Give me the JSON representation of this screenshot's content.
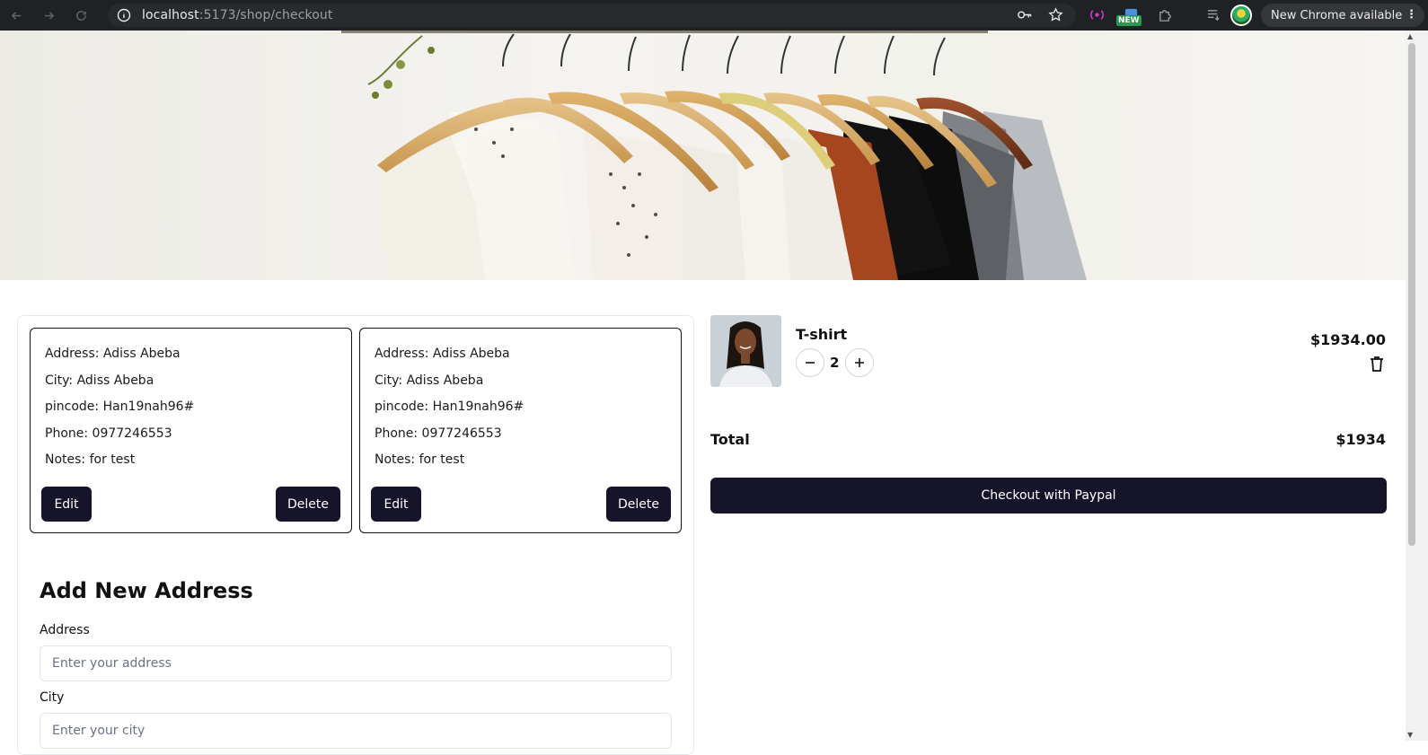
{
  "browser": {
    "url_host": "localhost",
    "url_path": ":5173/shop/checkout",
    "update_label": "New Chrome available",
    "new_badge": "NEW",
    "icons": [
      "back-icon",
      "forward-icon",
      "reload-icon",
      "site-info-icon",
      "key-icon",
      "bookmark-star-icon",
      "extension-icon",
      "puzzle-icon",
      "media-icon",
      "profile-avatar",
      "menu-dots-icon"
    ]
  },
  "hero": {
    "alt": ""
  },
  "addresses": [
    {
      "address": "Address: Adiss Abeba",
      "city": "City: Adiss Abeba",
      "pincode": "pincode: Han19nah96#",
      "phone": "Phone: 0977246553",
      "notes": "Notes: for test",
      "edit_label": "Edit",
      "delete_label": "Delete"
    },
    {
      "address": "Address: Adiss Abeba",
      "city": "City: Adiss Abeba",
      "pincode": "pincode: Han19nah96#",
      "phone": "Phone: 0977246553",
      "notes": "Notes: for test",
      "edit_label": "Edit",
      "delete_label": "Delete"
    }
  ],
  "form": {
    "title": "Add New Address",
    "address_label": "Address",
    "address_placeholder": "Enter your address",
    "city_label": "City",
    "city_placeholder": "Enter your city"
  },
  "cart": {
    "item_title": "T-shirt",
    "quantity": "2",
    "item_price": "$1934.00",
    "total_label": "Total",
    "total_value": "$1934",
    "checkout_label": "Checkout with Paypal"
  },
  "colors": {
    "primary_button": "#16142b",
    "chrome_bar": "#202124"
  }
}
